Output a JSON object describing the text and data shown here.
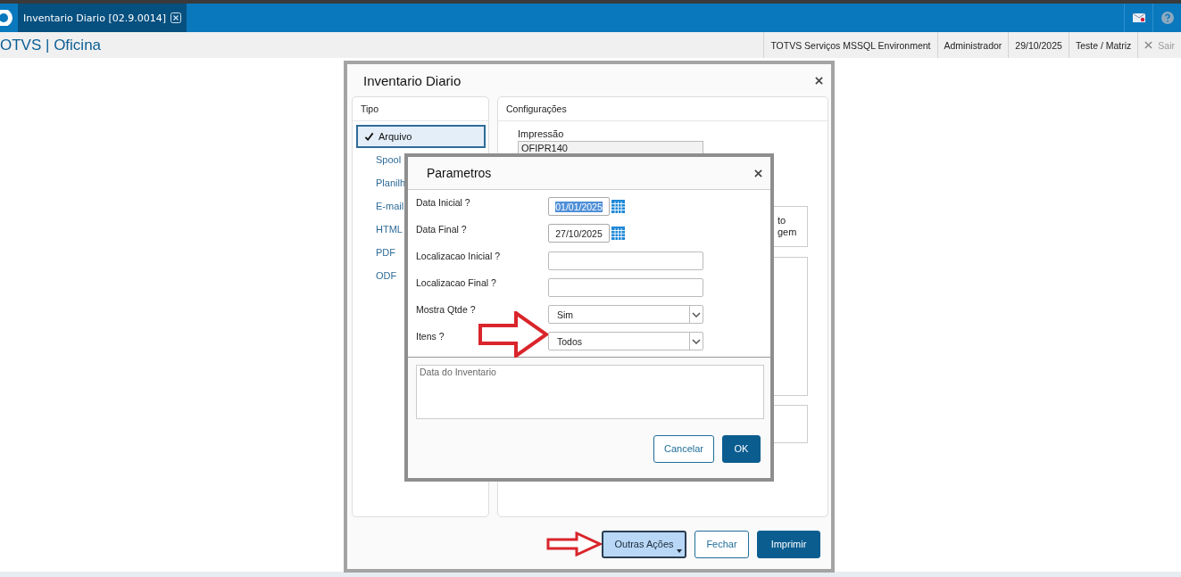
{
  "app": {
    "tab": {
      "title": "Inventario Diario [02.9.0014]",
      "selected": true
    },
    "brand": "OTVS | Oficina",
    "status": [
      "TOTVS Serviços MSSQL Environment",
      "Administrador",
      "29/10/2025",
      "Teste / Matriz"
    ],
    "logout": "Sair"
  },
  "dialog": {
    "title": "Inventario Diario",
    "tipo": {
      "title": "Tipo",
      "items": [
        {
          "label": "Arquivo",
          "selected": true
        },
        {
          "label": "Spool",
          "selected": false
        },
        {
          "label": "Planilh",
          "selected": false
        },
        {
          "label": "E-mail",
          "selected": false
        },
        {
          "label": "HTML",
          "selected": false
        },
        {
          "label": "PDF",
          "selected": false
        },
        {
          "label": "ODF",
          "selected": false
        }
      ]
    },
    "config": {
      "title": "Configurações",
      "impressao_label": "Impressão",
      "impressao_value": "OFIPR140",
      "fragments": [
        "to",
        "gem"
      ]
    },
    "buttons": [
      {
        "label": "Outras Ações",
        "kind": "menu"
      },
      {
        "label": "Fechar",
        "kind": "secondary"
      },
      {
        "label": "Imprimir",
        "kind": "primary"
      }
    ]
  },
  "params": {
    "title": "Parametros",
    "fields": [
      {
        "label": "Data Inicial ?",
        "kind": "date",
        "value": "01/01/2025",
        "highlighted": true
      },
      {
        "label": "Data Final ?",
        "kind": "date",
        "value": "27/10/2025",
        "highlighted": false
      },
      {
        "label": "Localizacao Inicial ?",
        "kind": "text"
      },
      {
        "label": "Localizacao Final ?",
        "kind": "text"
      },
      {
        "label": "Mostra Qtde ?",
        "kind": "select",
        "value": "Sim"
      },
      {
        "label": "Itens ?",
        "kind": "select",
        "value": "Todos"
      }
    ],
    "help_text": "Data do Inventario",
    "buttons": [
      {
        "label": "Cancelar",
        "kind": "secondary"
      },
      {
        "label": "OK",
        "kind": "primary"
      }
    ]
  }
}
